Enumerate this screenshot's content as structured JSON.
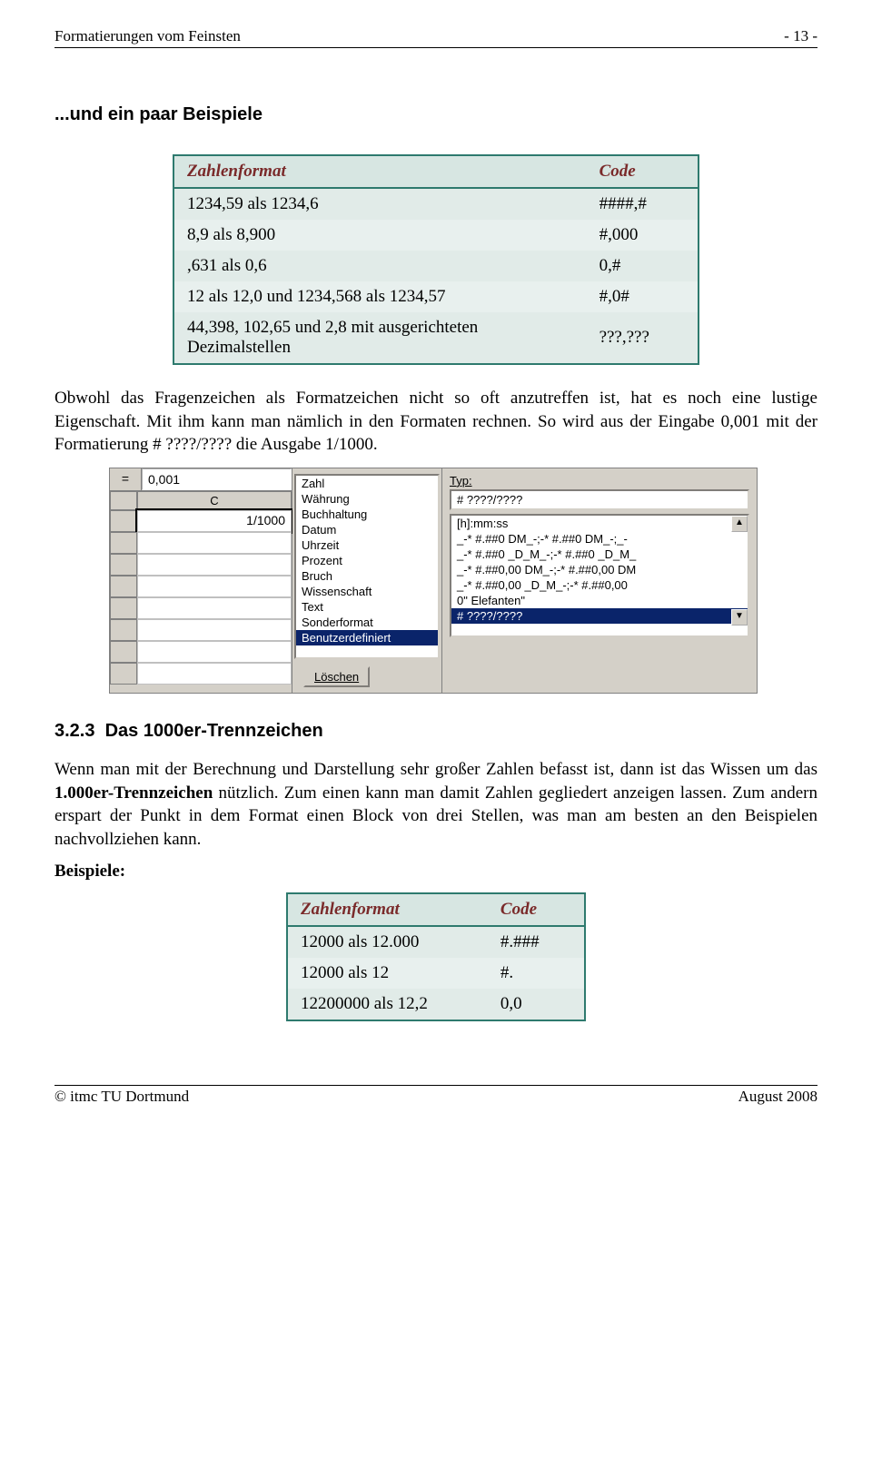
{
  "header": {
    "left": "Formatierungen vom Feinsten",
    "right": "- 13 -"
  },
  "intro_heading": "...und ein paar Beispiele",
  "table1": {
    "headers": [
      "Zahlenformat",
      "Code"
    ],
    "rows": [
      [
        "1234,59 als 1234,6",
        "####,#"
      ],
      [
        "8,9 als 8,900",
        "#,000"
      ],
      [
        ",631 als 0,6",
        "0,#"
      ],
      [
        "12 als 12,0 und 1234,568 als 1234,57",
        "#,0#"
      ],
      [
        "44,398, 102,65 und 2,8 mit ausgerichteten Dezimalstellen",
        "???,???"
      ]
    ]
  },
  "para1": "Obwohl das Fragenzeichen als Formatzeichen nicht so oft anzutreffen ist, hat es noch eine lustige Eigenschaft. Mit ihm kann man nämlich in den Formaten rechnen. So wird aus der Eingabe 0,001 mit der Formatierung # ????/???? die Ausgabe 1/1000.",
  "excel": {
    "formula_label": "=",
    "formula_value": "0,001",
    "col_header": "C",
    "cell_value": "1/1000",
    "categories": [
      "Zahl",
      "Währung",
      "Buchhaltung",
      "Datum",
      "Uhrzeit",
      "Prozent",
      "Bruch",
      "Wissenschaft",
      "Text",
      "Sonderformat",
      "Benutzerdefiniert"
    ],
    "delete_btn": "Löschen",
    "typ_label": "Typ:",
    "typ_value": "# ????/????",
    "typ_list": [
      "[h]:mm:ss",
      "_-* #.##0 DM_-;-* #.##0 DM_-;_-",
      "_-* #.##0 _D_M_-;-* #.##0 _D_M_",
      "_-* #.##0,00 DM_-;-* #.##0,00 DM",
      "_-* #.##0,00 _D_M_-;-* #.##0,00",
      "0\" Elefanten\"",
      "# ????/????"
    ]
  },
  "section": {
    "number": "3.2.3",
    "title": "Das 1000er-Trennzeichen"
  },
  "para2_part1": "Wenn man mit der Berechnung und Darstellung sehr großer Zahlen befasst ist, dann ist das Wissen um das ",
  "para2_bold": "1.000er-Trennzeichen",
  "para2_part2": " nützlich. Zum einen kann man damit Zahlen gegliedert anzeigen lassen. Zum andern erspart der Punkt in dem Format einen Block von drei Stellen, was man am besten an den Beispielen nachvollziehen kann.",
  "beispiele": "Beispiele:",
  "table2": {
    "headers": [
      "Zahlenformat",
      "Code"
    ],
    "rows": [
      [
        "12000 als 12.000",
        "#.###"
      ],
      [
        "12000 als 12",
        "#."
      ],
      [
        "12200000 als 12,2",
        "0,0"
      ]
    ]
  },
  "footer": {
    "left": "© itmc TU Dortmund",
    "right": "August 2008"
  }
}
